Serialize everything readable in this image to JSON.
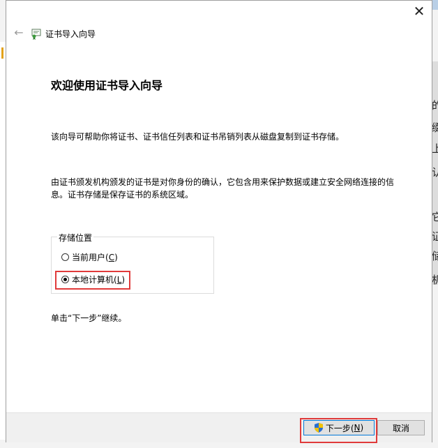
{
  "background": {
    "right_chars": [
      "的",
      "缀",
      "上",
      "认",
      "它",
      "证",
      "储",
      "机"
    ]
  },
  "dialog": {
    "title": "证书导入向导",
    "heading": "欢迎使用证书导入向导",
    "description_1": "该向导可帮助你将证书、证书信任列表和证书吊销列表从磁盘复制到证书存储。",
    "description_2": "由证书颁发机构颁发的证书是对你身份的确认，它包含用来保护数据或建立安全网络连接的信息。证书存储是保存证书的系统区域。",
    "store_location": {
      "legend": "存储位置",
      "options": [
        {
          "label": "当前用户(",
          "mnemonic": "C",
          "suffix": ")",
          "checked": false
        },
        {
          "label": "本地计算机(",
          "mnemonic": "L",
          "suffix": ")",
          "checked": true
        }
      ]
    },
    "continue_text": "单击“下一步”继续。",
    "buttons": {
      "next": {
        "label": "下一步(",
        "mnemonic": "N",
        "suffix": ")"
      },
      "cancel": "取消"
    }
  },
  "colors": {
    "highlight": "#e03a3a",
    "primary_border": "#0078d7"
  }
}
